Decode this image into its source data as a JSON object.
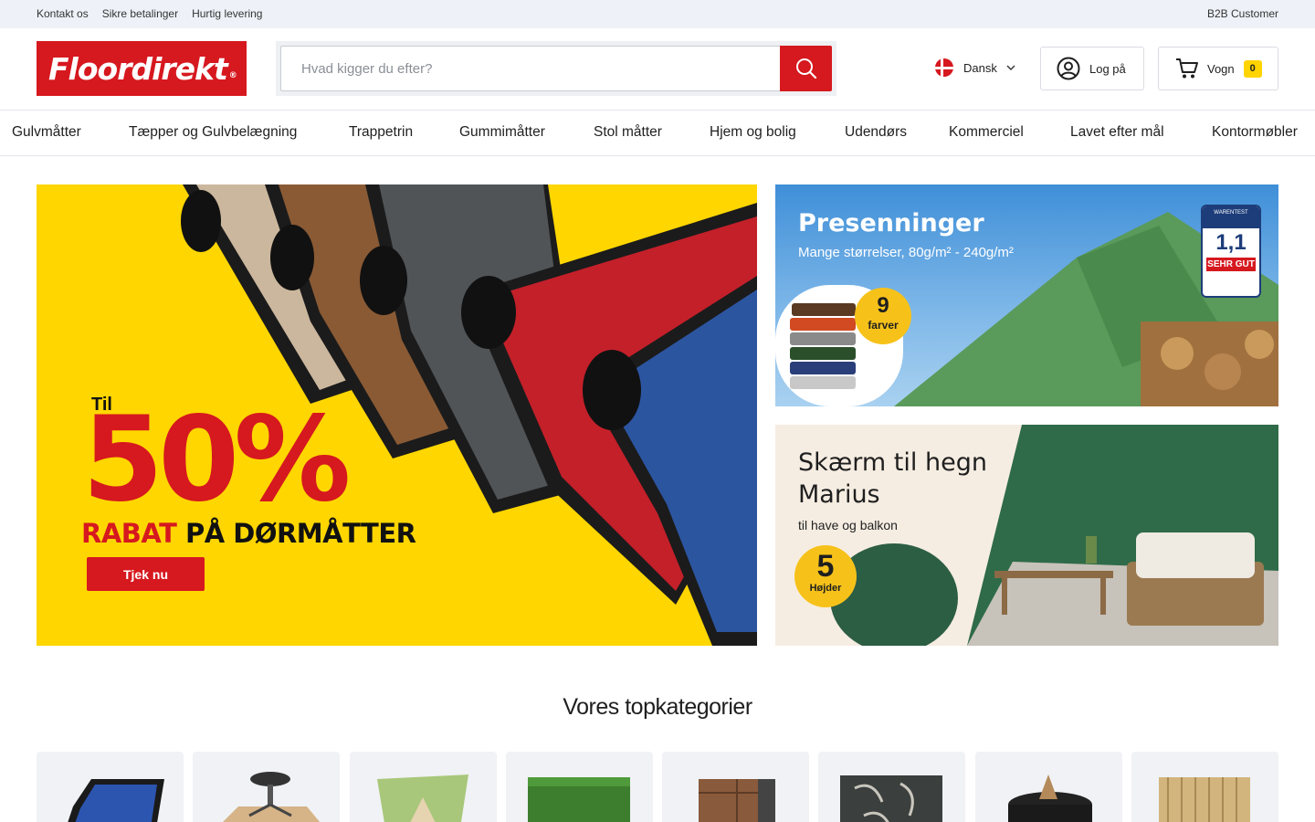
{
  "topbar": {
    "links": [
      "Kontakt os",
      "Sikre betalinger",
      "Hurtig levering"
    ],
    "b2b": "B2B Customer"
  },
  "header": {
    "logo_text": "Floordirekt",
    "logo_reg": "®",
    "search_placeholder": "Hvad kigger du efter?",
    "language": "Dansk",
    "login_label": "Log på",
    "cart_label": "Vogn",
    "cart_count": "0"
  },
  "nav": {
    "items": [
      "Gulvmåtter",
      "Tæpper og Gulvbelægning",
      "Trappetrin",
      "Gummimåtter",
      "Stol måtter",
      "Hjem og bolig",
      "Udendørs",
      "Kommerciel",
      "Lavet efter mål",
      "Kontormøbler"
    ]
  },
  "banners": {
    "hero": {
      "til": "Til",
      "percent": "50%",
      "rabat": "RABAT",
      "rest": " PÅ DØRMÅTTER",
      "cta": "Tjek nu"
    },
    "tarp": {
      "title": "Presenninger",
      "subtitle": "Mange størrelser, 80g/m² - 240g/m²",
      "badge_number": "9",
      "badge_text": "farver",
      "seal_top": "WARENTEST",
      "seal_value": "1,1",
      "seal_grade": "SEHR GUT"
    },
    "fence": {
      "title": "Skærm til hegn Marius",
      "subtitle": "til have og balkon",
      "badge_number": "5",
      "badge_text": "Højder"
    }
  },
  "categories": {
    "title": "Vores topkategorier",
    "items": [
      "doormat-image",
      "chairmat-image",
      "shade-sail-image",
      "artificial-grass-image",
      "deck-tile-image",
      "outdoor-rug-image",
      "fire-pit-image",
      "bamboo-fence-image"
    ]
  },
  "colors": {
    "brand_red": "#d6181f",
    "hero_yellow": "#ffd600",
    "badge_yellow": "#f6c21a",
    "topbar_bg": "#eef2f8"
  }
}
